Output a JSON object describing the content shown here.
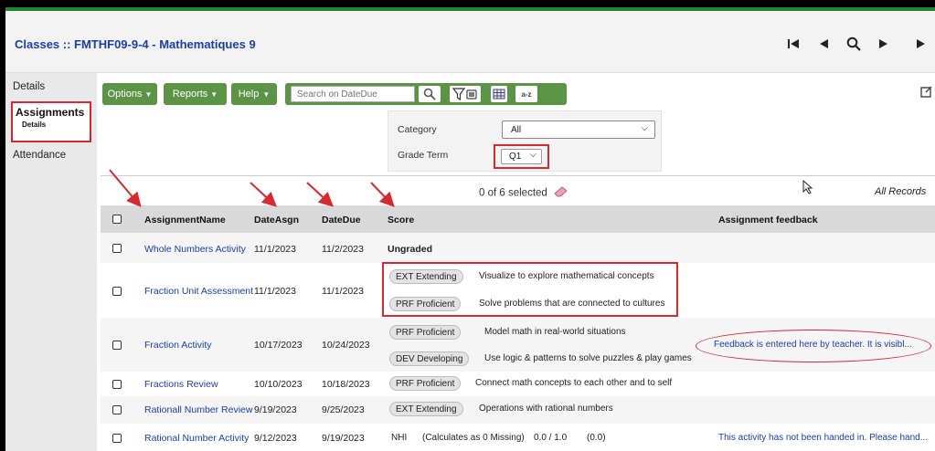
{
  "page": {
    "title": "Classes :: FMTHF09-9-4 - Mathematiques 9"
  },
  "nav": {
    "details": "Details",
    "assignments": "Assignments",
    "assignments_sub": "Details",
    "attendance": "Attendance"
  },
  "toolbar": {
    "options": "Options",
    "reports": "Reports",
    "help": "Help",
    "search_placeholder": "Search on DateDue",
    "az_label": "a-z"
  },
  "filters": {
    "category_label": "Category",
    "category_value": "All",
    "grade_term_label": "Grade Term",
    "grade_term_value": "Q1"
  },
  "selection": {
    "count_text": "0 of 6 selected",
    "all_records": "All Records"
  },
  "table": {
    "headers": {
      "name": "AssignmentName",
      "date_asgn": "DateAsgn",
      "date_due": "DateDue",
      "score": "Score",
      "feedback": "Assignment feedback"
    },
    "rows": [
      {
        "name": "Whole Numbers Activity",
        "date_asgn": "11/1/2023",
        "date_due": "11/2/2023",
        "score_text": "Ungraded"
      },
      {
        "name": "Fraction Unit Assessment",
        "date_asgn": "11/1/2023",
        "date_due": "11/1/2023",
        "scores": [
          {
            "badge": "EXT Extending",
            "desc": "Visualize to explore mathematical concepts"
          },
          {
            "badge": "PRF Proficient",
            "desc": "Solve problems that are connected to cultures"
          }
        ]
      },
      {
        "name": "Fraction Activity",
        "date_asgn": "10/17/2023",
        "date_due": "10/24/2023",
        "scores": [
          {
            "badge": "PRF Proficient",
            "desc": "Model math in real-world situations"
          },
          {
            "badge": "DEV Developing",
            "desc": "Use logic & patterns to solve puzzles & play games"
          }
        ],
        "feedback": "Feedback is entered here by teacher. It is visibl..."
      },
      {
        "name": "Fractions Review",
        "date_asgn": "10/10/2023",
        "date_due": "10/18/2023",
        "scores": [
          {
            "badge": "PRF Proficient",
            "desc": "Connect math concepts to each other and to self"
          }
        ]
      },
      {
        "name": "Rationall Number Review",
        "date_asgn": "9/19/2023",
        "date_due": "9/25/2023",
        "scores": [
          {
            "badge": "EXT Extending",
            "desc": "Operations with rational numbers"
          }
        ]
      },
      {
        "name": "Rational Number Activity",
        "date_asgn": "9/12/2023",
        "date_due": "9/19/2023",
        "score_code": "NHI",
        "score_note": "(Calculates as 0 Missing)",
        "score_points": "0.0 / 1.0",
        "score_pct": "(0.0)",
        "feedback": "This activity has not been handed in. Please hand..."
      }
    ]
  },
  "colors": {
    "accent_green": "#5a9444",
    "link_blue": "#1a3fa8",
    "annotation_red": "#d9282e",
    "top_bar_green": "#1f8a2c"
  }
}
